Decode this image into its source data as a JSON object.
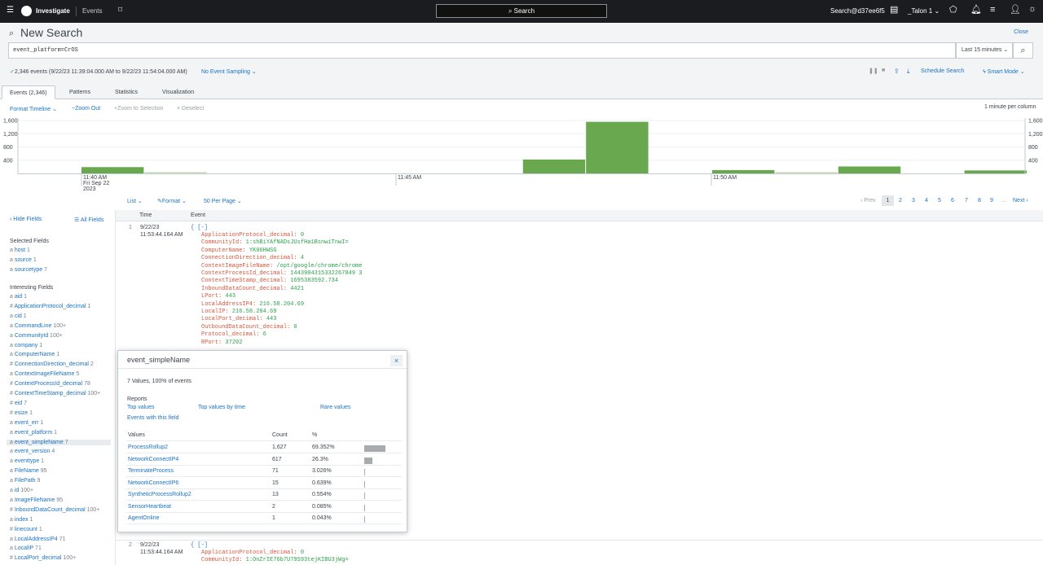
{
  "topbar": {
    "app": "Investigate",
    "section": "Events",
    "search_label": "Search",
    "user": "Search@d37ee6f5",
    "tenant": "_Talon 1"
  },
  "search": {
    "title": "New Search",
    "close": "Close",
    "query": "event_platform=CrOS",
    "range": "Last 15 minutes",
    "status": "2,346 events (9/22/23 11:39:04.000 AM to 9/22/23 11:54:04.000 AM)",
    "sampling": "No Event Sampling",
    "schedule": "Schedule Search",
    "mode": "Smart Mode"
  },
  "tabs": [
    {
      "label": "Events (2,346)"
    },
    {
      "label": "Patterns"
    },
    {
      "label": "Statistics"
    },
    {
      "label": "Visualization"
    }
  ],
  "timeline": {
    "format": "Format Timeline",
    "zoom_out": "−Zoom Out",
    "zoom_sel": "+Zoom to Selection",
    "deselect": "× Deselect",
    "scale": "1 minute per column"
  },
  "chart_data": {
    "type": "bar",
    "y_ticks": [
      "1,600",
      "1,200",
      "800",
      "400"
    ],
    "x_labels": [
      "11:40 AM",
      "Fri Sep 22",
      "2023",
      "11:45 AM",
      "11:50 AM"
    ],
    "ylim": [
      0,
      1600
    ],
    "values": [
      190,
      40,
      0,
      0,
      0,
      0,
      0,
      420,
      1560,
      0,
      100,
      40,
      210,
      0,
      90,
      0,
      0
    ]
  },
  "results": {
    "list": "List",
    "format": "Format",
    "per_page": "50 Per Page",
    "prev": "‹ Prev",
    "pages": [
      "1",
      "2",
      "3",
      "4",
      "5",
      "6",
      "7",
      "8",
      "9"
    ],
    "ellipsis": "...",
    "next": "Next ›"
  },
  "sidebar": {
    "hide": "‹ Hide Fields",
    "all": "All Fields",
    "selected_title": "Selected Fields",
    "interesting_title": "Interesting Fields",
    "selected": [
      {
        "t": "a",
        "n": "host",
        "c": "1"
      },
      {
        "t": "a",
        "n": "source",
        "c": "1"
      },
      {
        "t": "a",
        "n": "sourcetype",
        "c": "7"
      }
    ],
    "interesting": [
      {
        "t": "a",
        "n": "aid",
        "c": "1"
      },
      {
        "t": "#",
        "n": "ApplicationProtocol_decimal",
        "c": "1"
      },
      {
        "t": "a",
        "n": "cid",
        "c": "1"
      },
      {
        "t": "a",
        "n": "CommandLine",
        "c": "100+"
      },
      {
        "t": "a",
        "n": "CommunityId",
        "c": "100+"
      },
      {
        "t": "a",
        "n": "company",
        "c": "1"
      },
      {
        "t": "a",
        "n": "ComputerName",
        "c": "1"
      },
      {
        "t": "#",
        "n": "ConnectionDirection_decimal",
        "c": "2"
      },
      {
        "t": "a",
        "n": "ContextImageFileName",
        "c": "5"
      },
      {
        "t": "#",
        "n": "ContextProcessId_decimal",
        "c": "78"
      },
      {
        "t": "#",
        "n": "ContextTimeStamp_decimal",
        "c": "100+"
      },
      {
        "t": "#",
        "n": "eid",
        "c": "7"
      },
      {
        "t": "#",
        "n": "esize",
        "c": "1"
      },
      {
        "t": "a",
        "n": "event_err",
        "c": "1"
      },
      {
        "t": "a",
        "n": "event_platform",
        "c": "1"
      },
      {
        "t": "a",
        "n": "event_simpleName",
        "c": "7"
      },
      {
        "t": "a",
        "n": "event_version",
        "c": "4"
      },
      {
        "t": "a",
        "n": "eventtype",
        "c": "1"
      },
      {
        "t": "a",
        "n": "FileName",
        "c": "95"
      },
      {
        "t": "a",
        "n": "FilePath",
        "c": "9"
      },
      {
        "t": "a",
        "n": "id",
        "c": "100+"
      },
      {
        "t": "a",
        "n": "ImageFileName",
        "c": "95"
      },
      {
        "t": "#",
        "n": "InboundDataCount_decimal",
        "c": "100+"
      },
      {
        "t": "a",
        "n": "index",
        "c": "1"
      },
      {
        "t": "#",
        "n": "linecount",
        "c": "1"
      },
      {
        "t": "a",
        "n": "LocalAddressIP4",
        "c": "71"
      },
      {
        "t": "a",
        "n": "LocalIP",
        "c": "71"
      },
      {
        "t": "#",
        "n": "LocalPort_decimal",
        "c": "100+"
      }
    ]
  },
  "events": {
    "col_time": "Time",
    "col_event": "Event",
    "e1": {
      "num": "1",
      "date": "9/22/23",
      "time": "11:53:44.164 AM",
      "open": "{ [-]",
      "fields": [
        {
          "k": "ApplicationProtocol_decimal:",
          "v": "0"
        },
        {
          "k": "CommunityId:",
          "v": "1:shBiYAfNADsJUsfHa1BsnwiTnwI="
        },
        {
          "k": "ComputerName:",
          "v": "YK06HWSG"
        },
        {
          "k": "ConnectionDirection_decimal:",
          "v": "4"
        },
        {
          "k": "ContextImageFileName:",
          "v": "/opt/google/chrome/chrome"
        },
        {
          "k": "ContextProcessId_decimal:",
          "v": "1443904315332267849 3"
        },
        {
          "k": "ContextTimeStamp_decimal:",
          "v": "1695383592.734"
        },
        {
          "k": "InboundDataCount_decimal:",
          "v": "4421"
        },
        {
          "k": "LPort:",
          "v": "443"
        },
        {
          "k": "LocalAddressIP4:",
          "v": "216.58.204.69"
        },
        {
          "k": "LocalIP:",
          "v": "216.58.204.69"
        },
        {
          "k": "LocalPort_decimal:",
          "v": "443"
        },
        {
          "k": "OutboundDataCount_decimal:",
          "v": "0"
        },
        {
          "k": "Protocol_decimal:",
          "v": "6"
        },
        {
          "k": "RPort:",
          "v": "37202"
        }
      ]
    },
    "e2": {
      "num": "2",
      "date": "9/22/23",
      "time": "11:53:44.164 AM",
      "open": "{ [-]",
      "fields": [
        {
          "k": "ApplicationProtocol_decimal:",
          "v": "0"
        },
        {
          "k": "CommunityId:",
          "v": "1:OnZrIE76b7U79S93tejKIBU3jWg="
        }
      ]
    }
  },
  "popup": {
    "title": "event_simpleName",
    "summary": "7 Values, 100% of events",
    "reports": "Reports",
    "top_values": "Top values",
    "top_by_time": "Top values by time",
    "rare": "Rare values",
    "with_field": "Events with this field",
    "col_values": "Values",
    "col_count": "Count",
    "col_pct": "%",
    "rows": [
      {
        "name": "ProcessRollup2",
        "count": "1,627",
        "pct": "69.352%",
        "frac": 0.694
      },
      {
        "name": "NetworkConnectIP4",
        "count": "617",
        "pct": "26.3%",
        "frac": 0.263
      },
      {
        "name": "TerminateProcess",
        "count": "71",
        "pct": "3.026%",
        "frac": 0.03
      },
      {
        "name": "NetworkConnectIP6",
        "count": "15",
        "pct": "0.639%",
        "frac": 0.006
      },
      {
        "name": "SyntheticProcessRollup2",
        "count": "13",
        "pct": "0.554%",
        "frac": 0.006
      },
      {
        "name": "SensorHeartbeat",
        "count": "2",
        "pct": "0.085%",
        "frac": 0.001
      },
      {
        "name": "AgentOnline",
        "count": "1",
        "pct": "0.043%",
        "frac": 0.0004
      }
    ]
  }
}
